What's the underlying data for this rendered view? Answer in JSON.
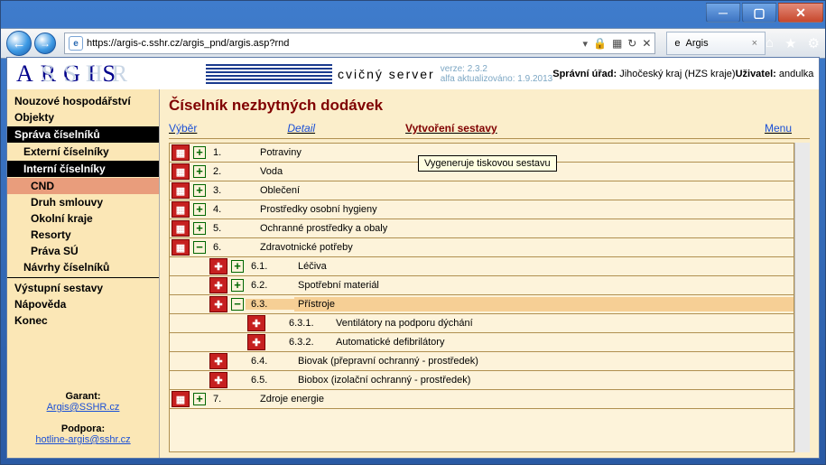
{
  "window": {
    "url": "https://argis-c.sshr.cz/argis_pnd/argis.asp?rnd",
    "tab_title": "Argis"
  },
  "app": {
    "logo": "ARGIS",
    "logo_shadow": "SSHR",
    "server_label": "cvičný server",
    "version": "verze: 2.3.2",
    "updated": "alfa aktualizováno: 1.9.2013",
    "admin_label": "Správní úřad:",
    "admin_value": "Jihočeský kraj (HZS kraje)",
    "user_label": "Uživatel:",
    "user_value": "andulka"
  },
  "sidebar": {
    "items": [
      {
        "t": "plain",
        "label": "Nouzové hospodářství"
      },
      {
        "t": "plain",
        "label": "Objekty"
      },
      {
        "t": "grp",
        "label": "Správa číselníků"
      },
      {
        "t": "l2b",
        "label": "Externí číselníky"
      },
      {
        "t": "sub",
        "label": "Interní číselníky"
      },
      {
        "t": "sel",
        "label": "CND"
      },
      {
        "t": "l2",
        "label": "Druh smlouvy"
      },
      {
        "t": "l2",
        "label": "Okolní kraje"
      },
      {
        "t": "l2",
        "label": "Resorty"
      },
      {
        "t": "l2",
        "label": "Práva SÚ"
      },
      {
        "t": "l2b",
        "label": "Návrhy číselníků"
      },
      {
        "t": "hr"
      },
      {
        "t": "plain",
        "label": "Výstupní sestavy"
      },
      {
        "t": "plain",
        "label": "Nápověda"
      },
      {
        "t": "plain",
        "label": "Konec"
      }
    ],
    "garant_label": "Garant:",
    "garant_link": "Argis@SSHR.cz",
    "podpora_label": "Podpora:",
    "podpora_link": "hotline-argis@sshr.cz"
  },
  "main": {
    "title": "Číselník nezbytných dodávek",
    "tabs": {
      "vyber": "Výběr",
      "detail": "Detail",
      "sestava": "Vytvoření sestavy",
      "menu": "Menu"
    },
    "tooltip": "Vygeneruje tiskovou sestavu"
  },
  "tree": [
    {
      "d": 0,
      "ic": "cat",
      "ex": "+",
      "num": "1.",
      "label": "Potraviny"
    },
    {
      "d": 0,
      "ic": "cat",
      "ex": "+",
      "num": "2.",
      "label": "Voda"
    },
    {
      "d": 0,
      "ic": "cat",
      "ex": "+",
      "num": "3.",
      "label": "Oblečení"
    },
    {
      "d": 0,
      "ic": "cat",
      "ex": "+",
      "num": "4.",
      "label": "Prostředky osobní hygieny"
    },
    {
      "d": 0,
      "ic": "cat",
      "ex": "+",
      "num": "5.",
      "label": "Ochranné prostředky a obaly"
    },
    {
      "d": 0,
      "ic": "cat",
      "ex": "−",
      "num": "6.",
      "label": "Zdravotnické potřeby"
    },
    {
      "d": 1,
      "ic": "med",
      "ex": "+",
      "num": "6.1.",
      "label": "Léčiva"
    },
    {
      "d": 1,
      "ic": "med",
      "ex": "+",
      "num": "6.2.",
      "label": "Spotřební materiál"
    },
    {
      "d": 1,
      "ic": "med",
      "ex": "−",
      "num": "6.3.",
      "label": "Přístroje",
      "sel": true
    },
    {
      "d": 2,
      "ic": "med",
      "ex": "",
      "num": "6.3.1.",
      "label": "Ventilátory na podporu dýchání"
    },
    {
      "d": 2,
      "ic": "med",
      "ex": "",
      "num": "6.3.2.",
      "label": "Automatické defibrilátory"
    },
    {
      "d": 1,
      "ic": "med",
      "ex": "",
      "num": "6.4.",
      "label": "Biovak (přepravní ochranný - prostředek)"
    },
    {
      "d": 1,
      "ic": "med",
      "ex": "",
      "num": "6.5.",
      "label": "Biobox (izolační ochranný - prostředek)"
    },
    {
      "d": 0,
      "ic": "cat",
      "ex": "+",
      "num": "7.",
      "label": "Zdroje energie"
    }
  ]
}
